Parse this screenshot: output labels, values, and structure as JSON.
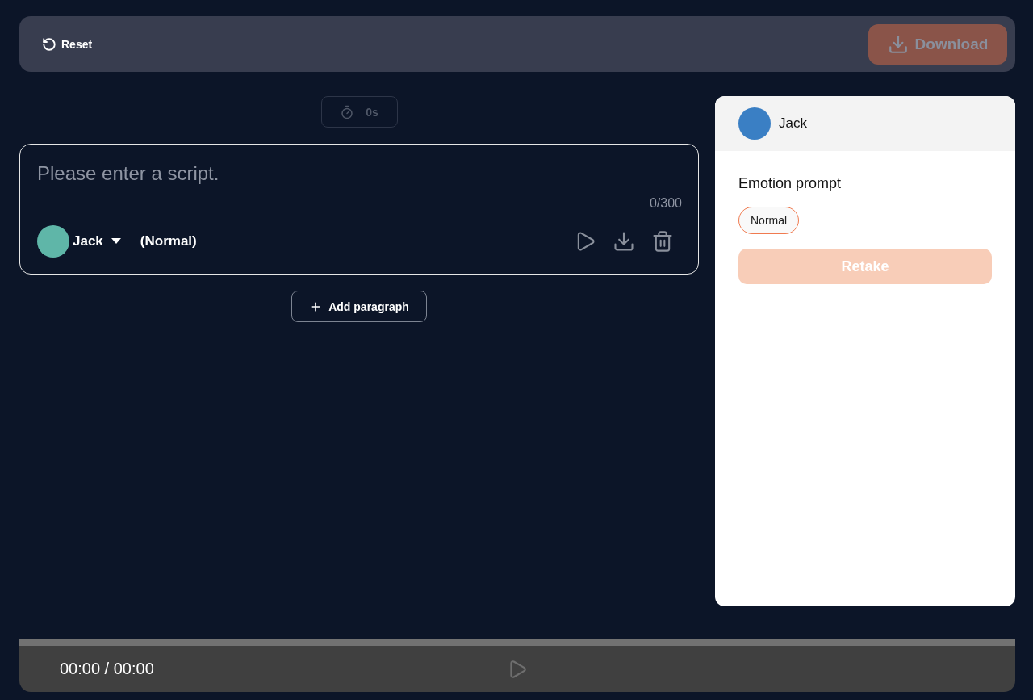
{
  "toolbar": {
    "reset": {
      "label": "Reset"
    },
    "download": {
      "label": "Download",
      "disabled": true
    }
  },
  "editor": {
    "timer": "0s",
    "paragraphs": [
      {
        "placeholder": "Please enter a script.",
        "counter": "0/300",
        "speaker": "Jack",
        "emotion": "(Normal)"
      }
    ],
    "add_paragraph": "Add paragraph"
  },
  "panel": {
    "speaker": "Jack",
    "heading": "Emotion prompt",
    "emotions": [
      {
        "label": "Normal",
        "selected": true
      }
    ],
    "retake": {
      "label": "Retake",
      "disabled": true
    }
  },
  "player": {
    "time": "00:00 / 00:00",
    "level": 0
  }
}
